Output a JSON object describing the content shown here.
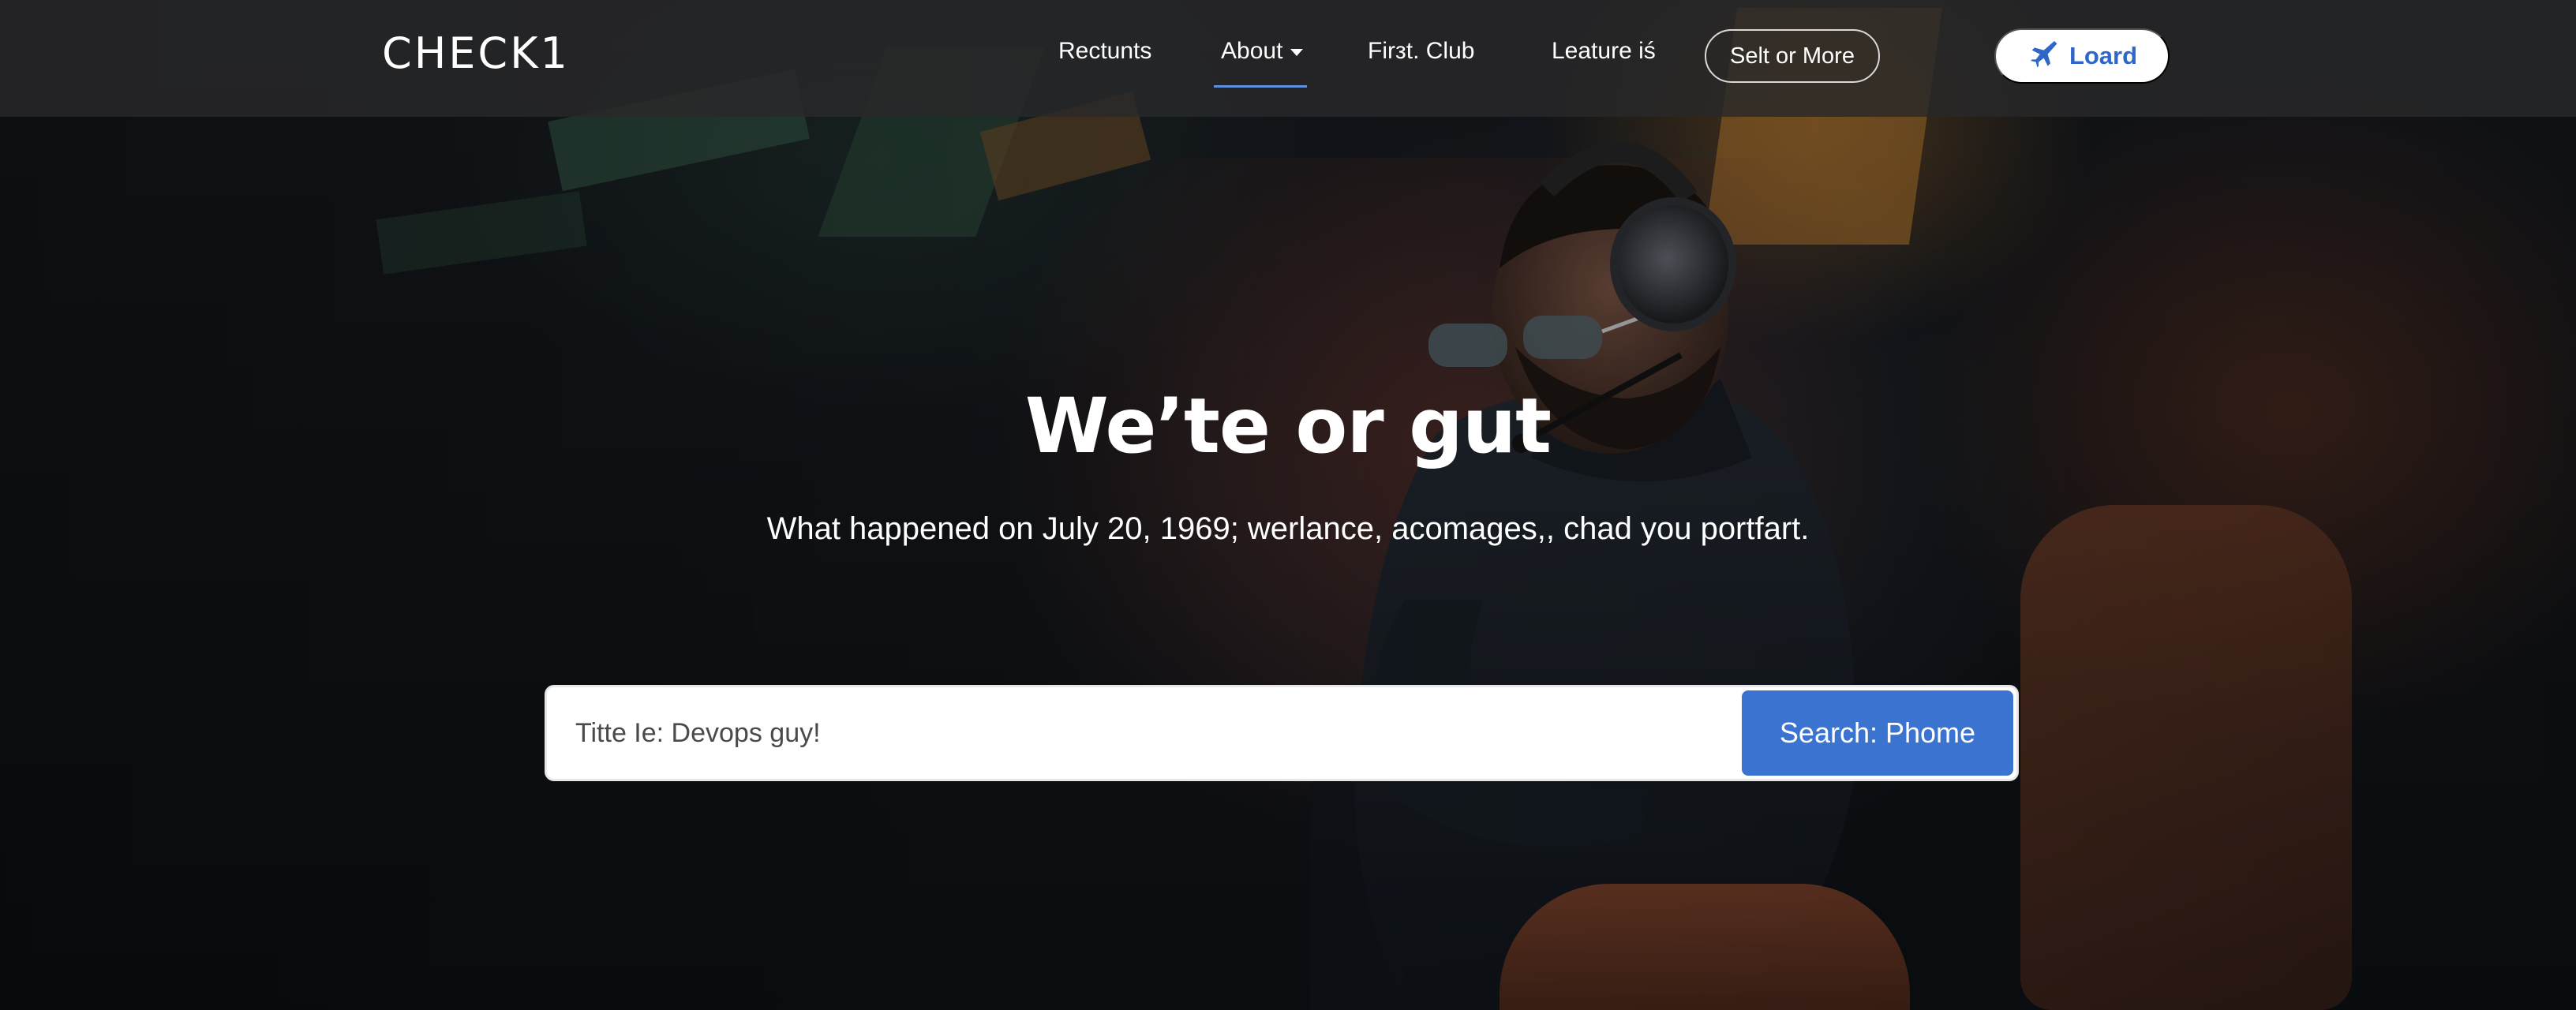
{
  "nav": {
    "logo": "CHECK1",
    "links": [
      {
        "label": "Rectunts"
      },
      {
        "label": "About"
      },
      {
        "label": "Firзt. Club"
      },
      {
        "label": "Leature iś"
      }
    ],
    "outline_button": "Selt or More",
    "primary_button": "Loard"
  },
  "hero": {
    "title": "We’te or gut",
    "subtitle": "What happened on July 20, 1969; werlance, acomages,,  chad you portfart."
  },
  "search": {
    "placeholder": "Titte Ie: Devops guy!",
    "button": "Search: Phome"
  },
  "colors": {
    "accent": "#3a73d0",
    "nav_bg": "#28282a",
    "underline": "#5f8fe0"
  },
  "icons": {
    "primary_button_icon": "plane-icon",
    "about_caret": "caret-down-icon"
  }
}
